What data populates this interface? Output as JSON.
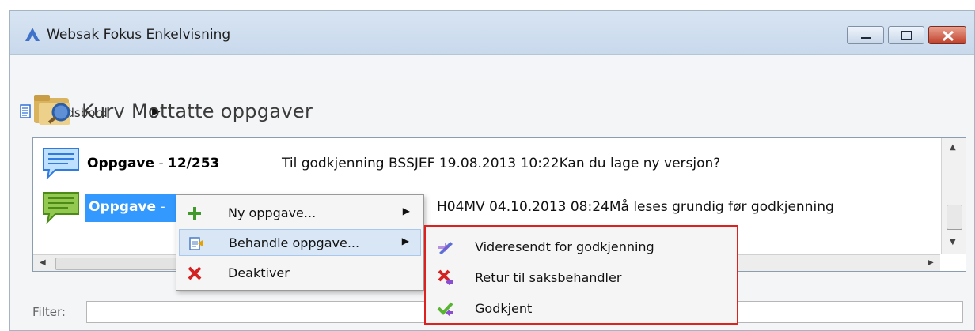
{
  "window": {
    "title": "Websak Fokus Enkelvisning"
  },
  "menu": {
    "breadcrumb": "Arbeidsbord"
  },
  "header": {
    "title": "Kurv Mottatte oppgaver"
  },
  "list": {
    "rows": [
      {
        "type": "Oppgave",
        "sep": " - ",
        "id": "12/253",
        "desc": "Til godkjenning BSSJEF  19.08.2013 10:22Kan du lage ny versjon?"
      },
      {
        "type": "Oppgave",
        "sep": " - ",
        "desc": "H04MV  04.10.2013 08:24Må leses grundig før godkjenning"
      }
    ]
  },
  "filter": {
    "label": "Filter:"
  },
  "context_menu": {
    "items": [
      {
        "label": "Ny oppgave...",
        "icon": "plus-icon",
        "submenu": true
      },
      {
        "label": "Behandle oppgave...",
        "icon": "clipboard-icon",
        "submenu": true
      },
      {
        "label": "Deaktiver",
        "icon": "x-icon",
        "submenu": false
      }
    ]
  },
  "submenu": {
    "items": [
      {
        "label": "Videresendt for godkjenning",
        "icon": "forward-pen-icon"
      },
      {
        "label": "Retur til saksbehandler",
        "icon": "return-icon"
      },
      {
        "label": "Godkjent",
        "icon": "approve-icon"
      }
    ]
  },
  "colors": {
    "selection": "#3399ff",
    "highlight_frame": "#e01f1f"
  }
}
